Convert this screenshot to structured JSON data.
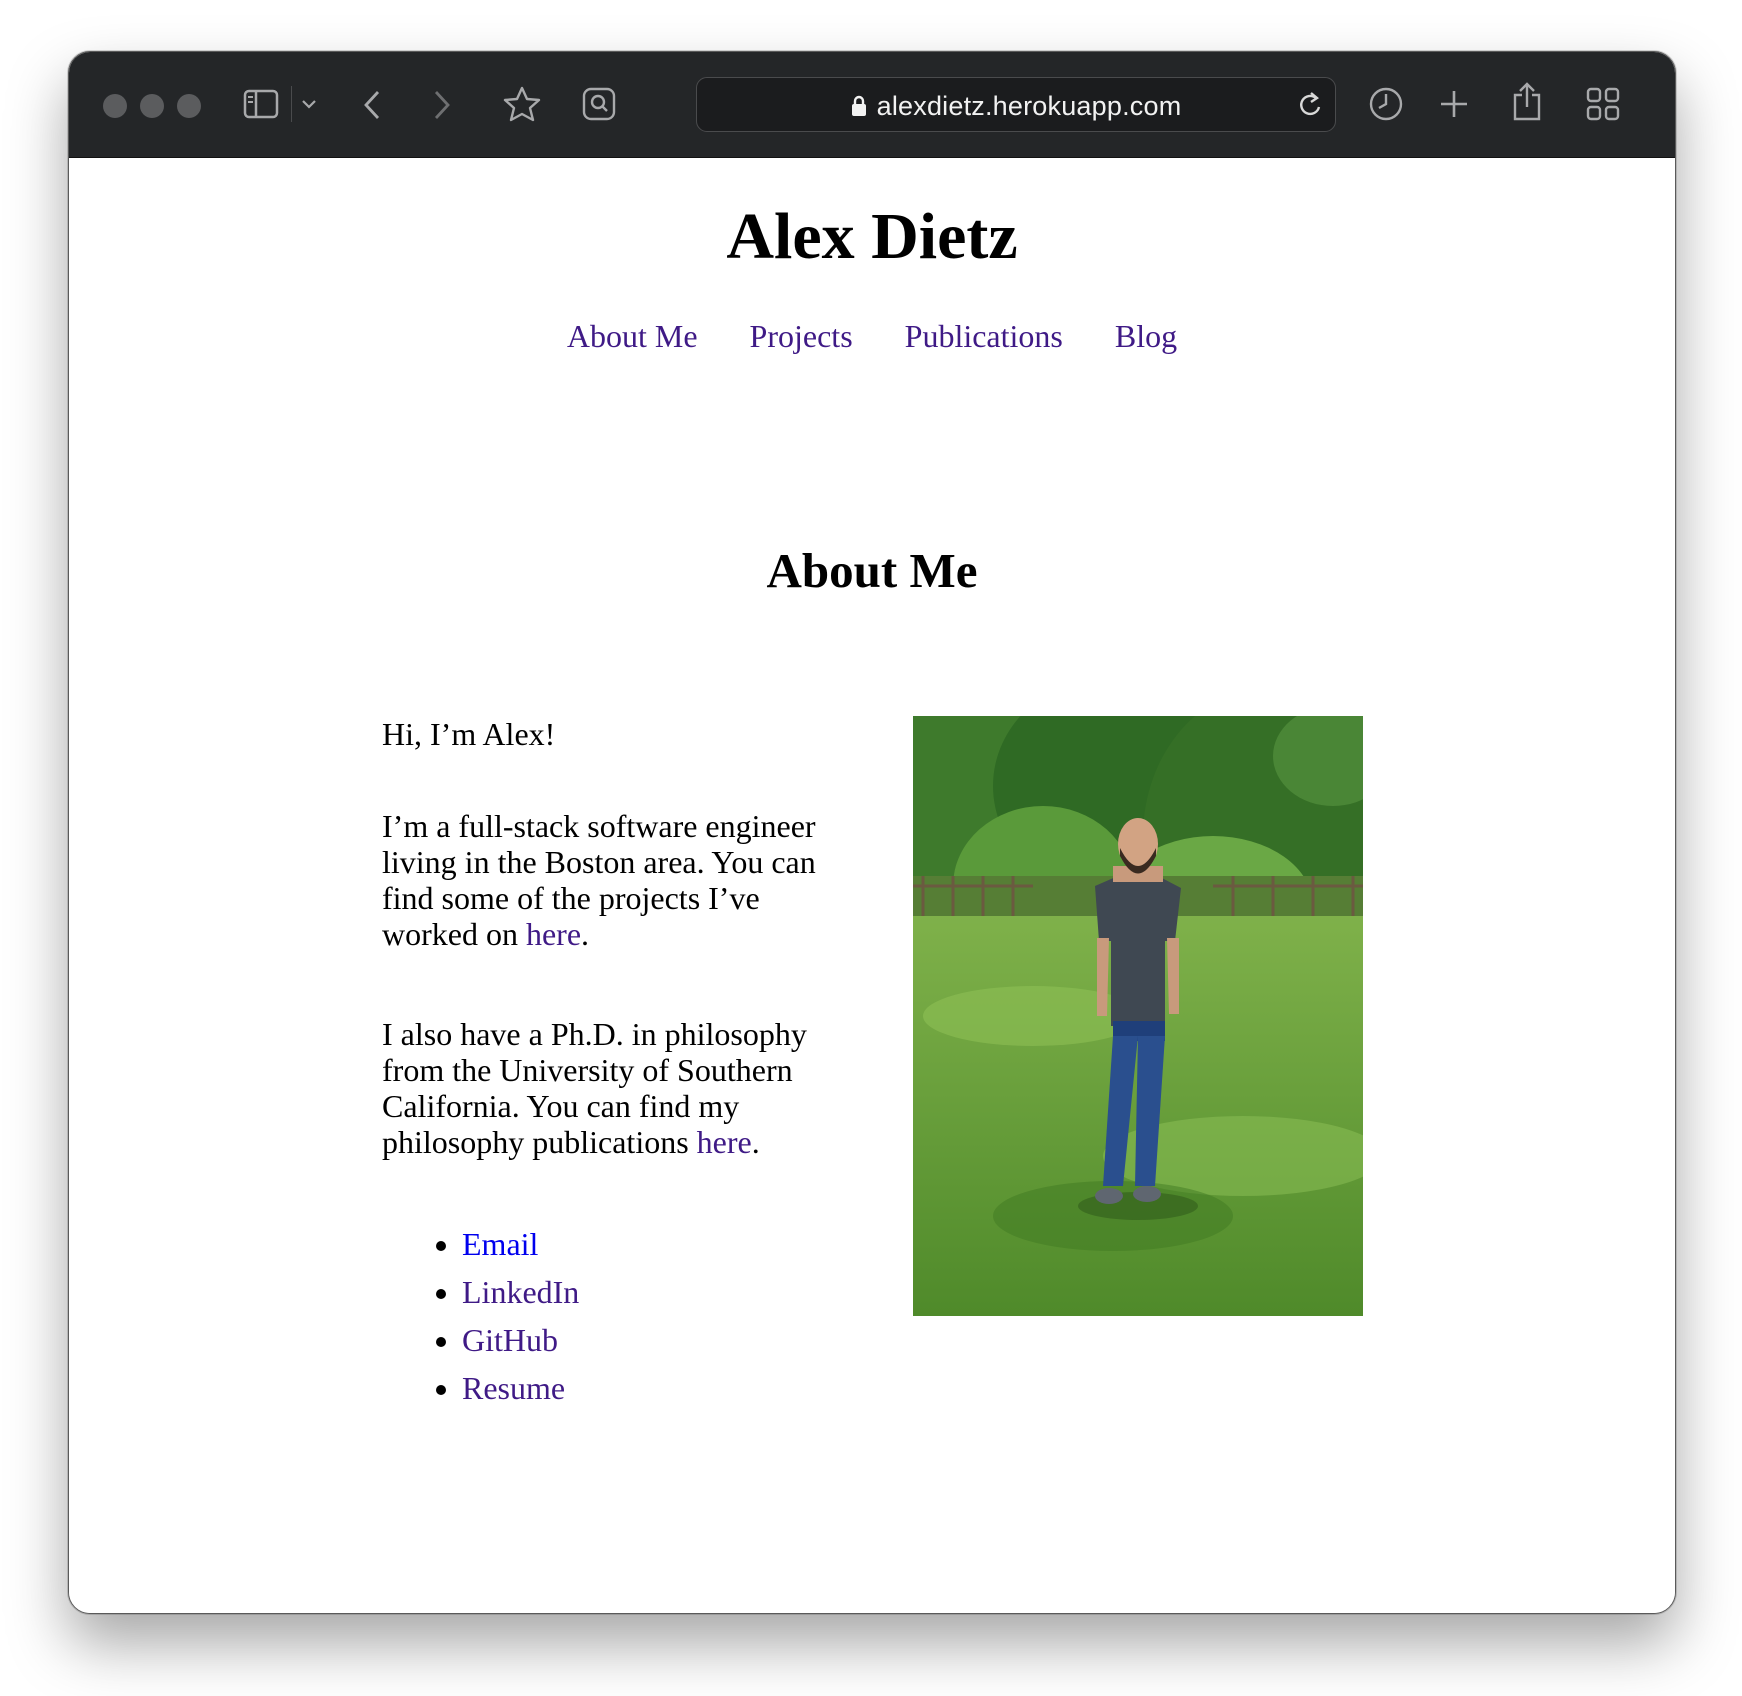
{
  "browser": {
    "url": "alexdietz.herokuapp.com",
    "icons": [
      "close-dot",
      "minimize-dot",
      "zoom-dot",
      "sidebar-icon",
      "chevron-down-icon",
      "back-icon",
      "forward-icon",
      "bookmark-star-icon",
      "reader-icon",
      "lock-icon",
      "reload-icon",
      "history-clock-icon",
      "new-tab-plus-icon",
      "share-icon",
      "tab-overview-icon"
    ]
  },
  "site": {
    "title": "Alex Dietz",
    "nav": [
      "About Me",
      "Projects",
      "Publications",
      "Blog"
    ]
  },
  "about": {
    "heading": "About Me",
    "greeting": "Hi, I’m Alex!",
    "p2_text": "I’m a full-stack software engineer living in the Boston area. You can find some of the projects I’ve worked on ",
    "p2_link": "here",
    "p2_end": ".",
    "p3_text": "I also have a Ph.D. in philosophy from the University of Southern California. You can find my philosophy publications ",
    "p3_link": "here",
    "p3_end": ".",
    "links": [
      "Email",
      "LinkedIn",
      "GitHub",
      "Resume"
    ]
  },
  "photo": {
    "subject": "person standing in grassy park"
  },
  "colors": {
    "toolbar": "#242628",
    "link_visited": "#3f1a86",
    "link_unvisited": "#0000ee"
  }
}
